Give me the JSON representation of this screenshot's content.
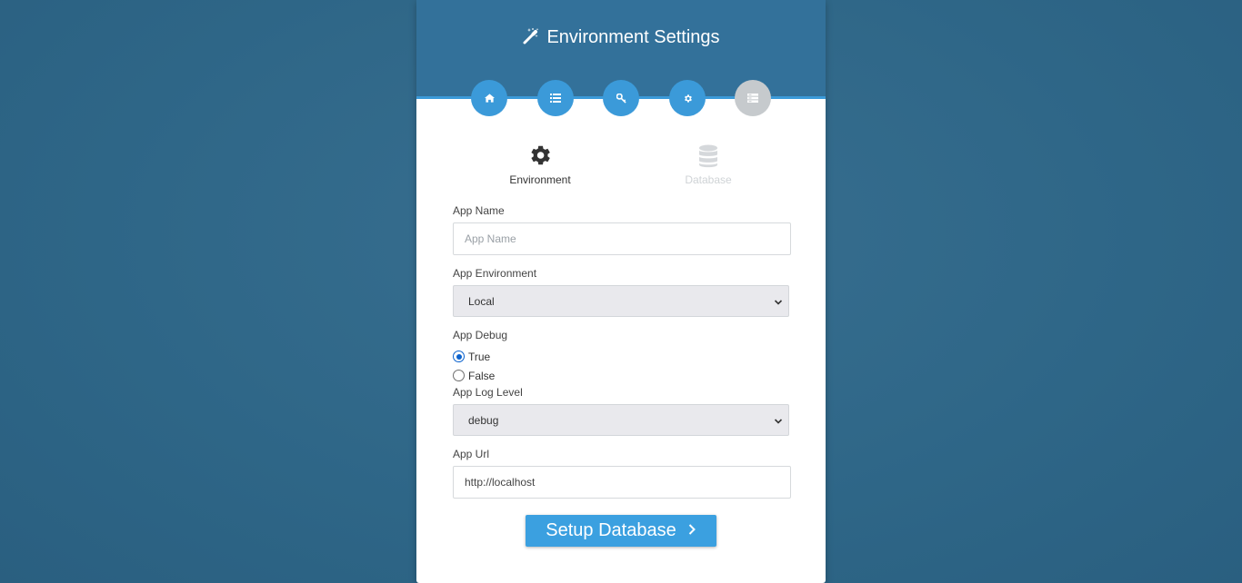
{
  "header": {
    "title": "Environment Settings",
    "icon": "magic-wand-icon"
  },
  "steps": [
    {
      "name": "home",
      "icon": "home-icon",
      "state": "complete"
    },
    {
      "name": "requirements",
      "icon": "list-icon",
      "state": "complete"
    },
    {
      "name": "permissions",
      "icon": "key-icon",
      "state": "complete"
    },
    {
      "name": "environment",
      "icon": "gear-icon",
      "state": "active"
    },
    {
      "name": "final",
      "icon": "server-icon",
      "state": "inactive"
    }
  ],
  "tabs": {
    "environment": {
      "label": "Environment",
      "icon": "gear-icon",
      "state": "active"
    },
    "database": {
      "label": "Database",
      "icon": "database-icon",
      "state": "disabled"
    }
  },
  "form": {
    "app_name": {
      "label": "App Name",
      "placeholder": "App Name",
      "value": ""
    },
    "app_environment": {
      "label": "App Environment",
      "value": "Local"
    },
    "app_debug": {
      "label": "App Debug",
      "options": [
        {
          "label": "True",
          "checked": true
        },
        {
          "label": "False",
          "checked": false
        }
      ]
    },
    "app_log_level": {
      "label": "App Log Level",
      "value": "debug"
    },
    "app_url": {
      "label": "App Url",
      "value": "http://localhost"
    }
  },
  "submit": {
    "label": "Setup Database"
  },
  "colors": {
    "background": "#2e6687",
    "header": "#33719a",
    "accent": "#3b9ad9",
    "inactive_step": "#c6cacd",
    "radio_checked": "#0b63ce"
  }
}
